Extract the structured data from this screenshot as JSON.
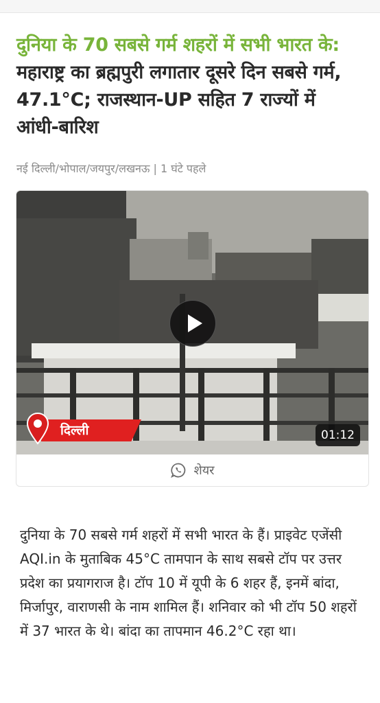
{
  "article": {
    "headline_highlight": "दुनिया के 70 सबसे गर्म शहरों में सभी भारत के:",
    "headline_rest": " महाराष्ट्र का ब्रह्मपुरी लगातार दूसरे दिन सबसे गर्म, 47.1°C; राजस्थान-UP सहित 7 राज्यों में आंधी-बारिश",
    "meta": "नई दिल्ली/भोपाल/जयपुर/लखनऊ | 1 घंटे पहले",
    "body": "दुनिया के 70 सबसे गर्म शहरों में सभी भारत के हैं। प्राइवेट एजेंसी AQI.in के मुताबिक 45°C तामपान के साथ सबसे टॉप पर उत्तर प्रदेश का प्रयागराज है। टॉप 10 में यूपी के 6 शहर हैं, इनमें बांदा, मिर्जापुर, वाराणसी के नाम शामिल हैं। शनिवार को भी टॉप 50 शहरों में 37 भारत के थे। बांदा का तापमान 46.2°C रहा था।"
  },
  "video": {
    "location": "दिल्ली",
    "duration": "01:12",
    "play_icon": "play-icon",
    "location_icon": "map-pin-icon"
  },
  "share": {
    "label": "शेयर",
    "icon": "whatsapp-icon"
  },
  "colors": {
    "headline_accent": "#78b43a",
    "location_ribbon": "#e02020",
    "text": "#2a2a2a",
    "meta": "#8a8a8a"
  }
}
